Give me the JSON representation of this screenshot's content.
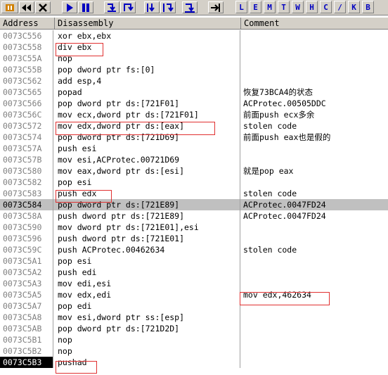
{
  "toolbar": {
    "icons": [
      "pause-icon",
      "rewind-icon",
      "close-icon",
      "play-icon",
      "pause2-icon",
      "step-into-icon",
      "step-over-icon",
      "trace-into-icon",
      "trace-over-icon",
      "execute-till-return-icon",
      "goto-icon"
    ],
    "letters": [
      "L",
      "E",
      "M",
      "T",
      "W",
      "H",
      "C",
      "/",
      "K",
      "B"
    ]
  },
  "columns": {
    "address": "Address",
    "disassembly": "Disassembly",
    "comment": "Comment"
  },
  "rows": [
    {
      "address": "0073C556",
      "disasm": "xor ebx,ebx",
      "comment": ""
    },
    {
      "address": "0073C558",
      "disasm": "div ebx",
      "comment": ""
    },
    {
      "address": "0073C55A",
      "disasm": "nop",
      "comment": ""
    },
    {
      "address": "0073C55B",
      "disasm": "pop dword ptr fs:[0]",
      "comment": ""
    },
    {
      "address": "0073C562",
      "disasm": "add esp,4",
      "comment": ""
    },
    {
      "address": "0073C565",
      "disasm": "popad",
      "comment": "恢复73BCA4的状态"
    },
    {
      "address": "0073C566",
      "disasm": "pop dword ptr ds:[721F01]",
      "comment": "ACProtec.00505DDC"
    },
    {
      "address": "0073C56C",
      "disasm": "mov ecx,dword ptr ds:[721F01]",
      "comment": "前面push ecx多余"
    },
    {
      "address": "0073C572",
      "disasm": "mov edx,dword ptr ds:[eax]",
      "comment": "stolen code"
    },
    {
      "address": "0073C574",
      "disasm": "pop dword ptr ds:[721D69]",
      "comment": "前面push eax也是假的"
    },
    {
      "address": "0073C57A",
      "disasm": "push esi",
      "comment": ""
    },
    {
      "address": "0073C57B",
      "disasm": "mov esi,ACProtec.00721D69",
      "comment": ""
    },
    {
      "address": "0073C580",
      "disasm": "mov eax,dword ptr ds:[esi]",
      "comment": "就是pop eax"
    },
    {
      "address": "0073C582",
      "disasm": "pop esi",
      "comment": ""
    },
    {
      "address": "0073C583",
      "disasm": "push edx",
      "comment": "stolen code"
    },
    {
      "address": "0073C584",
      "disasm": "pop dword ptr ds:[721E89]",
      "comment": "ACProtec.0047FD24"
    },
    {
      "address": "0073C58A",
      "disasm": "push dword ptr ds:[721E89]",
      "comment": "ACProtec.0047FD24"
    },
    {
      "address": "0073C590",
      "disasm": "mov dword ptr ds:[721E01],esi",
      "comment": ""
    },
    {
      "address": "0073C596",
      "disasm": "push dword ptr ds:[721E01]",
      "comment": ""
    },
    {
      "address": "0073C59C",
      "disasm": "push ACProtec.00462634",
      "comment": "stolen code"
    },
    {
      "address": "0073C5A1",
      "disasm": "pop esi",
      "comment": ""
    },
    {
      "address": "0073C5A2",
      "disasm": "push edi",
      "comment": ""
    },
    {
      "address": "0073C5A3",
      "disasm": "mov edi,esi",
      "comment": ""
    },
    {
      "address": "0073C5A5",
      "disasm": "mov edx,edi",
      "comment": "mov edx,462634"
    },
    {
      "address": "0073C5A7",
      "disasm": "pop edi",
      "comment": ""
    },
    {
      "address": "0073C5A8",
      "disasm": "mov esi,dword ptr ss:[esp]",
      "comment": ""
    },
    {
      "address": "0073C5AB",
      "disasm": "pop dword ptr ds:[721D2D]",
      "comment": ""
    },
    {
      "address": "0073C5B1",
      "disasm": "nop",
      "comment": ""
    },
    {
      "address": "0073C5B2",
      "disasm": "nop",
      "comment": ""
    },
    {
      "address": "0073C5B3",
      "disasm": "pushad",
      "comment": ""
    }
  ],
  "colors": {
    "annotation": "#e03030",
    "selected_row": "#c0c0c0",
    "toolbar_blue": "#0000c0"
  }
}
